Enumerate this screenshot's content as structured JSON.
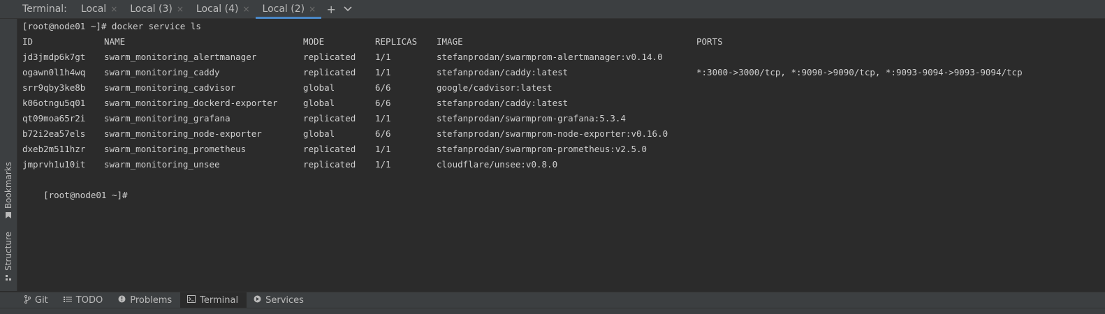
{
  "tabbar": {
    "title": "Terminal:",
    "tabs": [
      {
        "label": "Local",
        "active": false
      },
      {
        "label": "Local (3)",
        "active": false
      },
      {
        "label": "Local (4)",
        "active": false
      },
      {
        "label": "Local (2)",
        "active": true
      }
    ],
    "close_glyph": "×",
    "add_glyph": "+",
    "menu_glyph": "⌄"
  },
  "left_strip": {
    "bookmarks_label": "Bookmarks",
    "structure_label": "Structure"
  },
  "terminal": {
    "command_line": "[root@node01 ~]# docker service ls",
    "headers": {
      "id": "ID",
      "name": "NAME",
      "mode": "MODE",
      "replicas": "REPLICAS",
      "image": "IMAGE",
      "ports": "PORTS"
    },
    "rows": [
      {
        "id": "jd3jmdp6k7gt",
        "name": "swarm_monitoring_alertmanager",
        "mode": "replicated",
        "replicas": "1/1",
        "image": "stefanprodan/swarmprom-alertmanager:v0.14.0",
        "ports": ""
      },
      {
        "id": "ogawn0l1h4wq",
        "name": "swarm_monitoring_caddy",
        "mode": "replicated",
        "replicas": "1/1",
        "image": "stefanprodan/caddy:latest",
        "ports": "*:3000->3000/tcp, *:9090->9090/tcp, *:9093-9094->9093-9094/tcp"
      },
      {
        "id": "srr9qby3ke8b",
        "name": "swarm_monitoring_cadvisor",
        "mode": "global",
        "replicas": "6/6",
        "image": "google/cadvisor:latest",
        "ports": ""
      },
      {
        "id": "k06otngu5q01",
        "name": "swarm_monitoring_dockerd-exporter",
        "mode": "global",
        "replicas": "6/6",
        "image": "stefanprodan/caddy:latest",
        "ports": ""
      },
      {
        "id": "qt09moa65r2i",
        "name": "swarm_monitoring_grafana",
        "mode": "replicated",
        "replicas": "1/1",
        "image": "stefanprodan/swarmprom-grafana:5.3.4",
        "ports": ""
      },
      {
        "id": "b72i2ea57els",
        "name": "swarm_monitoring_node-exporter",
        "mode": "global",
        "replicas": "6/6",
        "image": "stefanprodan/swarmprom-node-exporter:v0.16.0",
        "ports": ""
      },
      {
        "id": "dxeb2m511hzr",
        "name": "swarm_monitoring_prometheus",
        "mode": "replicated",
        "replicas": "1/1",
        "image": "stefanprodan/swarmprom-prometheus:v2.5.0",
        "ports": ""
      },
      {
        "id": "jmprvh1u10it",
        "name": "swarm_monitoring_unsee",
        "mode": "replicated",
        "replicas": "1/1",
        "image": "cloudflare/unsee:v0.8.0",
        "ports": ""
      }
    ],
    "prompt_line": "[root@node01 ~]#"
  },
  "bottombar": {
    "tools": [
      {
        "label": "Git",
        "icon": "branch-icon",
        "active": false
      },
      {
        "label": "TODO",
        "icon": "list-icon",
        "active": false
      },
      {
        "label": "Problems",
        "icon": "info-icon",
        "active": false
      },
      {
        "label": "Terminal",
        "icon": "terminal-icon",
        "active": true
      },
      {
        "label": "Services",
        "icon": "play-icon",
        "active": false
      }
    ]
  },
  "colors": {
    "background": "#2b2b2b",
    "panel": "#3c3f41",
    "text": "#bbbbbb",
    "terminal_text": "#cfcfcf",
    "accent": "#4a88c7"
  }
}
